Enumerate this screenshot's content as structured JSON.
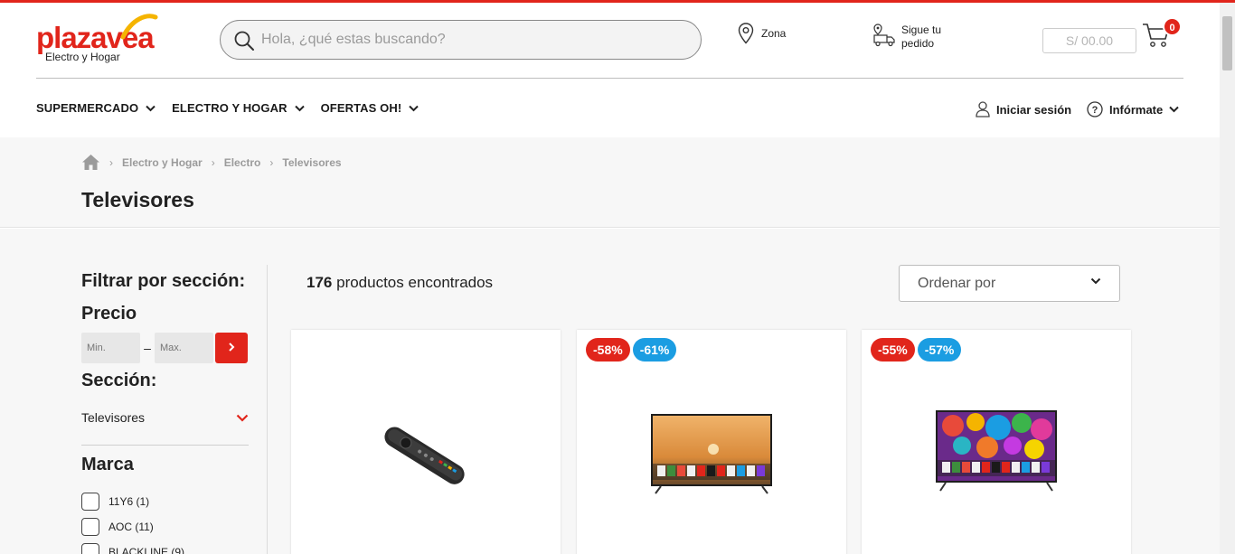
{
  "brand": {
    "logo_text_plaza": "plaza",
    "logo_text_vea": "vea",
    "logo_sub": "Electro y Hogar",
    "accent_color": "#e1251b",
    "badge_blue": "#1b9de2"
  },
  "search": {
    "placeholder": "Hola, ¿qué estas buscando?",
    "icon": "search-icon"
  },
  "header": {
    "zona_label": "Zona",
    "pedido_label": "Sigue tu pedido",
    "cart_total": "S/ 00.00",
    "cart_count": "0"
  },
  "nav": {
    "items": [
      {
        "label": "SUPERMERCADO"
      },
      {
        "label": "ELECTRO Y HOGAR"
      },
      {
        "label": "OFERTAS OH!"
      }
    ],
    "login_label": "Iniciar sesión",
    "info_label": "Infórmate"
  },
  "breadcrumb": {
    "items": [
      "Electro y Hogar",
      "Electro",
      "Televisores"
    ]
  },
  "page_title": "Televisores",
  "filters": {
    "title": "Filtrar por sección:",
    "price_title": "Precio",
    "min_placeholder": "Min.",
    "max_placeholder": "Max.",
    "price_dash": "–",
    "section_title": "Sección:",
    "section_value": "Televisores",
    "brand_title": "Marca",
    "brands": [
      {
        "label": "11Y6 (1)"
      },
      {
        "label": "AOC (11)"
      },
      {
        "label": "BLACKLINE (9)"
      }
    ]
  },
  "results": {
    "count": "176",
    "count_suffix": "productos encontrados",
    "sort_placeholder": "Ordenar por"
  },
  "products": [
    {
      "badges": [],
      "image": "tv-remote-image"
    },
    {
      "badges": [
        {
          "text": "-58%",
          "color": "red"
        },
        {
          "text": "-61%",
          "color": "blue"
        }
      ],
      "image": "tv-landscape-image"
    },
    {
      "badges": [
        {
          "text": "-55%",
          "color": "red"
        },
        {
          "text": "-57%",
          "color": "blue"
        }
      ],
      "image": "tv-colorful-image"
    }
  ]
}
